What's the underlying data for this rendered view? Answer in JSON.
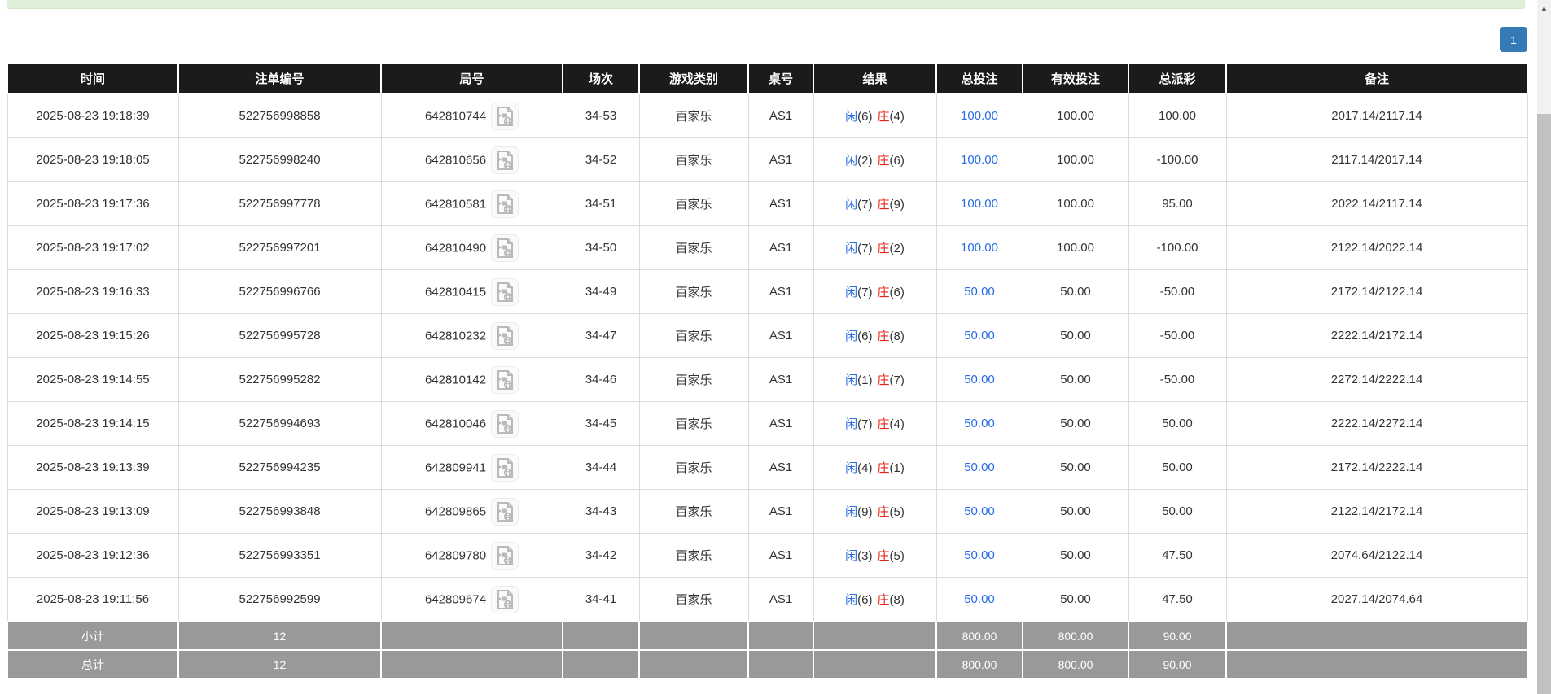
{
  "colors": {
    "alert_green": "#dff0d8",
    "accent_blue": "#337ab7",
    "header_bg": "#1b1b1b",
    "summary_gray": "#999999",
    "bet_blue": "#2a6ce6",
    "player_blue": "#2a6ce6",
    "banker_red": "#e8251c",
    "negative_red": "#f50f0f"
  },
  "icons": {
    "round_video": "video-replay-icon",
    "scrollbar_up": "▲"
  },
  "pagination": {
    "current_page": "1"
  },
  "table": {
    "columns": [
      "时间",
      "注单编号",
      "局号",
      "场次",
      "游戏类别",
      "桌号",
      "结果",
      "总投注",
      "有效投注",
      "总派彩",
      "备注"
    ],
    "rows": [
      {
        "time": "2025-08-23 19:18:39",
        "bet_id": "522756998858",
        "round_id": "642810744",
        "session": "34-53",
        "game_type": "百家乐",
        "table_id": "AS1",
        "player_label": "闲",
        "player_num": "(6)",
        "banker_label": "庄",
        "banker_num": "(4)",
        "total_bet": "100.00",
        "valid_bet": "100.00",
        "payout": "100.00",
        "remark": "2017.14/2117.14"
      },
      {
        "time": "2025-08-23 19:18:05",
        "bet_id": "522756998240",
        "round_id": "642810656",
        "session": "34-52",
        "game_type": "百家乐",
        "table_id": "AS1",
        "player_label": "闲",
        "player_num": "(2)",
        "banker_label": "庄",
        "banker_num": "(6)",
        "total_bet": "100.00",
        "valid_bet": "100.00",
        "payout": "-100.00",
        "remark": "2117.14/2017.14"
      },
      {
        "time": "2025-08-23 19:17:36",
        "bet_id": "522756997778",
        "round_id": "642810581",
        "session": "34-51",
        "game_type": "百家乐",
        "table_id": "AS1",
        "player_label": "闲",
        "player_num": "(7)",
        "banker_label": "庄",
        "banker_num": "(9)",
        "total_bet": "100.00",
        "valid_bet": "100.00",
        "payout": "95.00",
        "remark": "2022.14/2117.14"
      },
      {
        "time": "2025-08-23 19:17:02",
        "bet_id": "522756997201",
        "round_id": "642810490",
        "session": "34-50",
        "game_type": "百家乐",
        "table_id": "AS1",
        "player_label": "闲",
        "player_num": "(7)",
        "banker_label": "庄",
        "banker_num": "(2)",
        "total_bet": "100.00",
        "valid_bet": "100.00",
        "payout": "-100.00",
        "remark": "2122.14/2022.14"
      },
      {
        "time": "2025-08-23 19:16:33",
        "bet_id": "522756996766",
        "round_id": "642810415",
        "session": "34-49",
        "game_type": "百家乐",
        "table_id": "AS1",
        "player_label": "闲",
        "player_num": "(7)",
        "banker_label": "庄",
        "banker_num": "(6)",
        "total_bet": "50.00",
        "valid_bet": "50.00",
        "payout": "-50.00",
        "remark": "2172.14/2122.14"
      },
      {
        "time": "2025-08-23 19:15:26",
        "bet_id": "522756995728",
        "round_id": "642810232",
        "session": "34-47",
        "game_type": "百家乐",
        "table_id": "AS1",
        "player_label": "闲",
        "player_num": "(6)",
        "banker_label": "庄",
        "banker_num": "(8)",
        "total_bet": "50.00",
        "valid_bet": "50.00",
        "payout": "-50.00",
        "remark": "2222.14/2172.14"
      },
      {
        "time": "2025-08-23 19:14:55",
        "bet_id": "522756995282",
        "round_id": "642810142",
        "session": "34-46",
        "game_type": "百家乐",
        "table_id": "AS1",
        "player_label": "闲",
        "player_num": "(1)",
        "banker_label": "庄",
        "banker_num": "(7)",
        "total_bet": "50.00",
        "valid_bet": "50.00",
        "payout": "-50.00",
        "remark": "2272.14/2222.14"
      },
      {
        "time": "2025-08-23 19:14:15",
        "bet_id": "522756994693",
        "round_id": "642810046",
        "session": "34-45",
        "game_type": "百家乐",
        "table_id": "AS1",
        "player_label": "闲",
        "player_num": "(7)",
        "banker_label": "庄",
        "banker_num": "(4)",
        "total_bet": "50.00",
        "valid_bet": "50.00",
        "payout": "50.00",
        "remark": "2222.14/2272.14"
      },
      {
        "time": "2025-08-23 19:13:39",
        "bet_id": "522756994235",
        "round_id": "642809941",
        "session": "34-44",
        "game_type": "百家乐",
        "table_id": "AS1",
        "player_label": "闲",
        "player_num": "(4)",
        "banker_label": "庄",
        "banker_num": "(1)",
        "total_bet": "50.00",
        "valid_bet": "50.00",
        "payout": "50.00",
        "remark": "2172.14/2222.14"
      },
      {
        "time": "2025-08-23 19:13:09",
        "bet_id": "522756993848",
        "round_id": "642809865",
        "session": "34-43",
        "game_type": "百家乐",
        "table_id": "AS1",
        "player_label": "闲",
        "player_num": "(9)",
        "banker_label": "庄",
        "banker_num": "(5)",
        "total_bet": "50.00",
        "valid_bet": "50.00",
        "payout": "50.00",
        "remark": "2122.14/2172.14"
      },
      {
        "time": "2025-08-23 19:12:36",
        "bet_id": "522756993351",
        "round_id": "642809780",
        "session": "34-42",
        "game_type": "百家乐",
        "table_id": "AS1",
        "player_label": "闲",
        "player_num": "(3)",
        "banker_label": "庄",
        "banker_num": "(5)",
        "total_bet": "50.00",
        "valid_bet": "50.00",
        "payout": "47.50",
        "remark": "2074.64/2122.14"
      },
      {
        "time": "2025-08-23 19:11:56",
        "bet_id": "522756992599",
        "round_id": "642809674",
        "session": "34-41",
        "game_type": "百家乐",
        "table_id": "AS1",
        "player_label": "闲",
        "player_num": "(6)",
        "banker_label": "庄",
        "banker_num": "(8)",
        "total_bet": "50.00",
        "valid_bet": "50.00",
        "payout": "47.50",
        "remark": "2027.14/2074.64"
      }
    ],
    "subtotal": {
      "label": "小计",
      "count": "12",
      "total_bet": "800.00",
      "valid_bet": "800.00",
      "payout": "90.00"
    },
    "total": {
      "label": "总计",
      "count": "12",
      "total_bet": "800.00",
      "valid_bet": "800.00",
      "payout": "90.00"
    }
  },
  "scrollbar": {
    "up_glyph": "▲"
  }
}
